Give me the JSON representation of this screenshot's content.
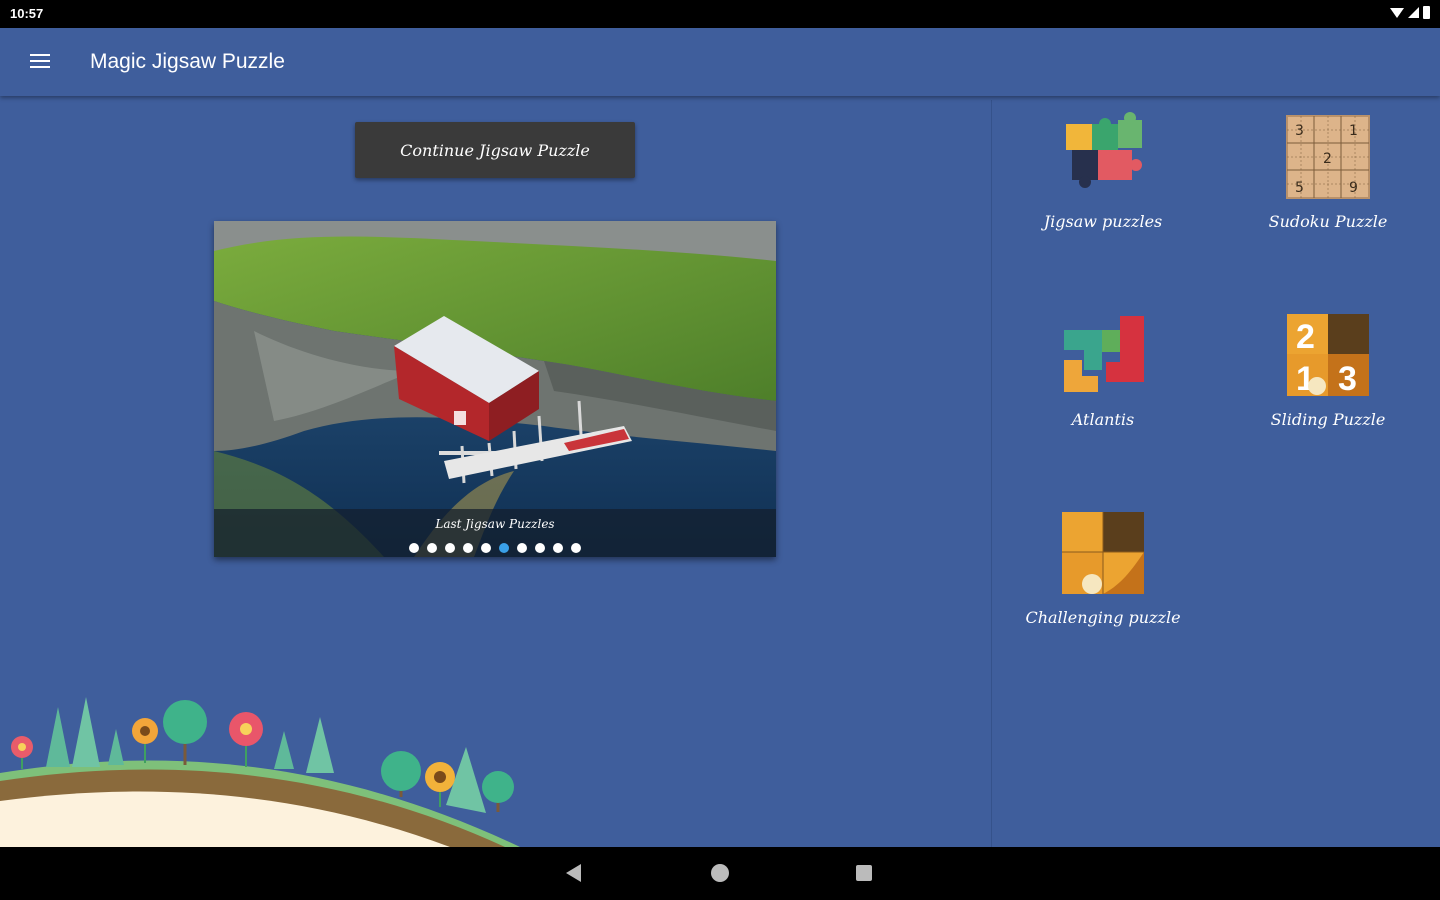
{
  "status_bar": {
    "time": "10:57"
  },
  "app_bar": {
    "title": "Magic Jigsaw Puzzle"
  },
  "main": {
    "continue_label": "Continue Jigsaw Puzzle",
    "carousel": {
      "caption": "Last Jigsaw Puzzles",
      "dot_count": 10,
      "active_dot": 5
    }
  },
  "games": [
    {
      "label": "Jigsaw puzzles",
      "icon": "jigsaw-pieces-icon"
    },
    {
      "label": "Sudoku Puzzle",
      "icon": "sudoku-grid-icon"
    },
    {
      "label": "Atlantis",
      "icon": "atlantis-blocks-icon"
    },
    {
      "label": "Sliding Puzzle",
      "icon": "sliding-tiles-icon"
    },
    {
      "label": "Challenging puzzle",
      "icon": "challenging-puzzle-icon"
    }
  ],
  "sudoku_digits": [
    "3",
    "1",
    "2",
    "5",
    "9"
  ],
  "sliding_digits": [
    "2",
    "1",
    "3"
  ],
  "colors": {
    "background": "#3f5e9c",
    "button": "#3a3a3a",
    "active_dot": "#3aa0e8"
  }
}
